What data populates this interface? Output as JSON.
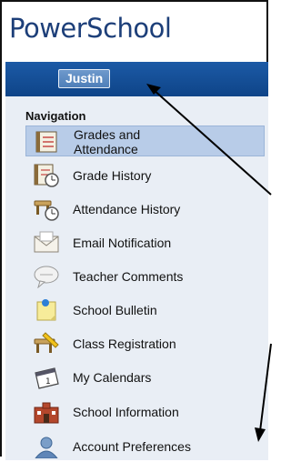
{
  "header": {
    "logo_text": "PowerSchool"
  },
  "user_bar": {
    "name": "Justin"
  },
  "navigation": {
    "title": "Navigation",
    "items": [
      {
        "label": "Grades and Attendance",
        "icon": "gradebook-icon",
        "selected": true
      },
      {
        "label": "Grade History",
        "icon": "grade-history-icon"
      },
      {
        "label": "Attendance History",
        "icon": "attendance-history-icon"
      },
      {
        "label": "Email Notification",
        "icon": "email-icon"
      },
      {
        "label": "Teacher Comments",
        "icon": "comments-icon"
      },
      {
        "label": "School Bulletin",
        "icon": "bulletin-icon"
      },
      {
        "label": "Class Registration",
        "icon": "registration-icon"
      },
      {
        "label": "My Calendars",
        "icon": "calendar-icon"
      },
      {
        "label": "School Information",
        "icon": "school-icon"
      },
      {
        "label": "Account Preferences",
        "icon": "account-icon"
      }
    ]
  },
  "colors": {
    "brand_blue": "#1d3f79",
    "bar_blue": "#0e4488",
    "selected_bg": "#b8cce8",
    "sidebar_bg": "#e9eef5"
  }
}
